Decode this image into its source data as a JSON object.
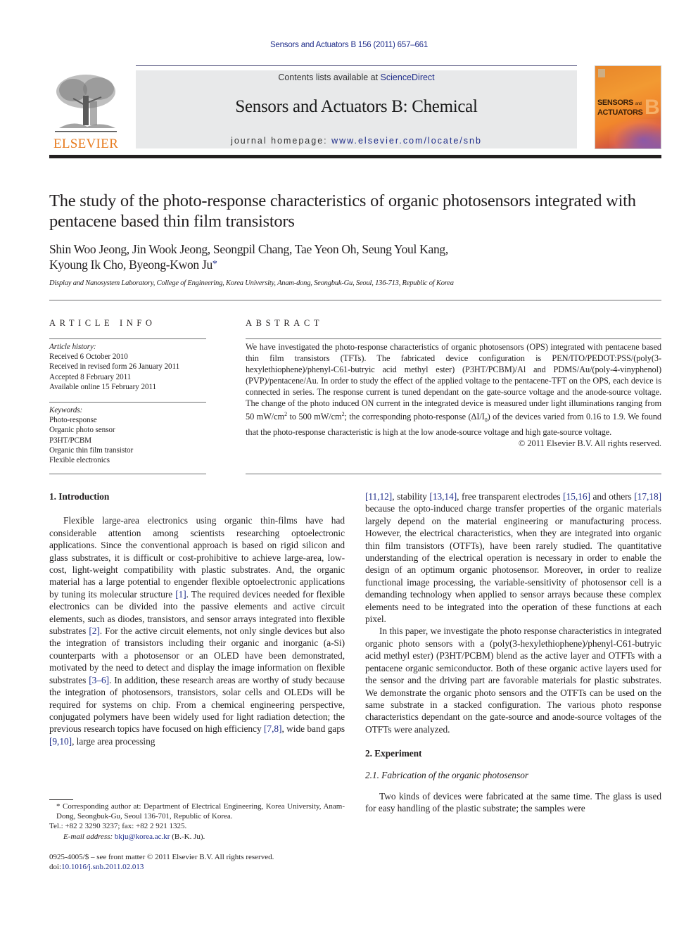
{
  "header": {
    "citation": "Sensors and Actuators B 156 (2011) 657–661",
    "publisher_logo_text": "ELSEVIER",
    "contents_prefix": "Contents lists available at ",
    "contents_link": "ScienceDirect",
    "journal_name": "Sensors and Actuators B: Chemical",
    "homepage_prefix": "journal homepage: ",
    "homepage_link": "www.elsevier.com/locate/snb",
    "cover": {
      "title_line1": "SENSORS",
      "title_and": "and",
      "title_line2": "ACTUATORS",
      "letter": "B"
    },
    "colors": {
      "link": "#1f2d8a",
      "elsevier_orange": "#e77b1f",
      "masthead_bg": "#e8e9ea"
    }
  },
  "article": {
    "title": "The study of the photo-response characteristics of organic photosensors integrated with pentacene based thin film transistors",
    "authors_line1": "Shin Woo Jeong, Jin Wook Jeong, Seongpil Chang, Tae Yeon Oh, Seung Youl Kang,",
    "authors_line2": "Kyoung Ik Cho, Byeong-Kwon Ju",
    "corresponding_mark": "*",
    "affiliation": "Display and Nanosystem Laboratory, College of Engineering, Korea University, Anam-dong, Seongbuk-Gu, Seoul, 136-713, Republic of Korea"
  },
  "article_info": {
    "heading": "ARTICLE INFO",
    "history_heading": "Article history:",
    "history": [
      "Received 6 October 2010",
      "Received in revised form 26 January 2011",
      "Accepted 8 February 2011",
      "Available online 15 February 2011"
    ],
    "keywords_heading": "Keywords:",
    "keywords": [
      "Photo-response",
      "Organic photo sensor",
      "P3HT/PCBM",
      "Organic thin film transistor",
      "Flexible electronics"
    ]
  },
  "abstract": {
    "heading": "ABSTRACT",
    "p1": "We have investigated the photo-response characteristics of organic photosensors (OPS) integrated with pentacene based thin film transistors (TFTs). The fabricated device configuration is PEN/ITO/PEDOT:PSS/(poly(3-hexylethiophene)/phenyl-C61-butryic acid methyl ester) (P3HT/PCBM)/Al and PDMS/Au/(poly-4-vinyphenol) (PVP)/pentacene/Au. In order to study the effect of the applied voltage to the pentacene-TFT on the OPS, each device is connected in series. The response current is tuned dependant on the gate-source voltage and the anode-source voltage. The change of the photo induced ON current in the integrated device is measured under light illuminations ranging from 50 mW/cm",
    "sup1": "2",
    "p2": " to 500 mW/cm",
    "sup2": "2",
    "p3": "; the corresponding photo-response (ΔI/I",
    "sub0": "0",
    "p4": ") of the devices varied from 0.16 to 1.9. We found that the photo-response characteristic is high at the low anode-source voltage and high gate-source voltage.",
    "copyright": "© 2011 Elsevier B.V. All rights reserved."
  },
  "body": {
    "intro_heading": "1.  Introduction",
    "intro_p1_a": "Flexible large-area electronics using organic thin-films have had considerable attention among scientists researching optoelectronic applications. Since the conventional approach is based on rigid silicon and glass substrates, it is difficult or cost-prohibitive to achieve large-area, low-cost, light-weight compatibility with plastic substrates. And, the organic material has a large potential to engender flexible optoelectronic applications by tuning its molecular structure ",
    "ref1": "[1]",
    "intro_p1_b": ". The required devices needed for flexible electronics can be divided into the passive elements and active circuit elements, such as diodes, transistors, and sensor arrays integrated into flexible substrates ",
    "ref2": "[2]",
    "intro_p1_c": ". For the active circuit elements, not only single devices but also the integration of transistors including their organic and inorganic (a-Si) counterparts with a photosensor or an OLED have been demonstrated, motivated by the need to detect and display the image information on flexible substrates ",
    "ref3": "[3–6]",
    "intro_p1_d": ". In addition, these research areas are worthy of study because the integration of photosensors, transistors, solar cells and OLEDs will be required for systems on chip. From a chemical engineering perspective, conjugated polymers have been widely used for light radiation detection; the previous research topics have focused on high efficiency ",
    "ref4": "[7,8]",
    "intro_p1_e": ", wide band gaps ",
    "ref5": "[9,10]",
    "intro_p1_f": ", large area processing ",
    "ref6": "[11,12]",
    "intro_p1_g": ", stability ",
    "ref7": "[13,14]",
    "intro_p1_h": ", free transparent electrodes ",
    "ref8": "[15,16]",
    "intro_p1_i": " and others ",
    "ref9": "[17,18]",
    "intro_p1_j": " because the opto-induced charge transfer properties of the organic materials largely depend on the material engineering or manufacturing process. However, the electrical characteristics, when they are integrated into organic thin film transistors (OTFTs), have been rarely studied. The quantitative understanding of the electrical operation is necessary in order to enable the design of an optimum organic photosensor. Moreover, in order to realize functional image processing, the variable-sensitivity of photosensor cell is a demanding technology when applied to sensor arrays because these complex elements need to be integrated into the operation of these functions at each pixel.",
    "intro_p2": "In this paper, we investigate the photo response characteristics in integrated organic photo sensors with a (poly(3-hexylethiophene)/phenyl-C61-butryic acid methyl ester) (P3HT/PCBM) blend as the active layer and OTFTs with a pentacene organic semiconductor. Both of these organic active layers used for the sensor and the driving part are favorable materials for plastic substrates. We demonstrate the organic photo sensors and the OTFTs can be used on the same substrate in a stacked configuration. The various photo response characteristics dependant on the gate-source and anode-source voltages of the OTFTs were analyzed.",
    "exp_heading": "2.  Experiment",
    "exp_sub_heading": "2.1.  Fabrication of the organic photosensor",
    "exp_p1": "Two kinds of devices were fabricated at the same time. The glass is used for easy handling of the plastic substrate; the samples were"
  },
  "footnote": {
    "mark": "*",
    "corresponding": " Corresponding author at: Department of Electrical Engineering, Korea University, Anam-Dong, Seongbuk-Gu, Seoul 136-701, Republic of Korea.",
    "tel": "Tel.: +82 2 3290 3237; fax: +82 2 921 1325.",
    "email_label": "E-mail address: ",
    "email": "bkju@korea.ac.kr",
    "email_suffix": " (B.-K. Ju).",
    "issn": "0925-4005/$ – see front matter © 2011 Elsevier B.V. All rights reserved.",
    "doi_prefix": "doi:",
    "doi": "10.1016/j.snb.2011.02.013"
  }
}
